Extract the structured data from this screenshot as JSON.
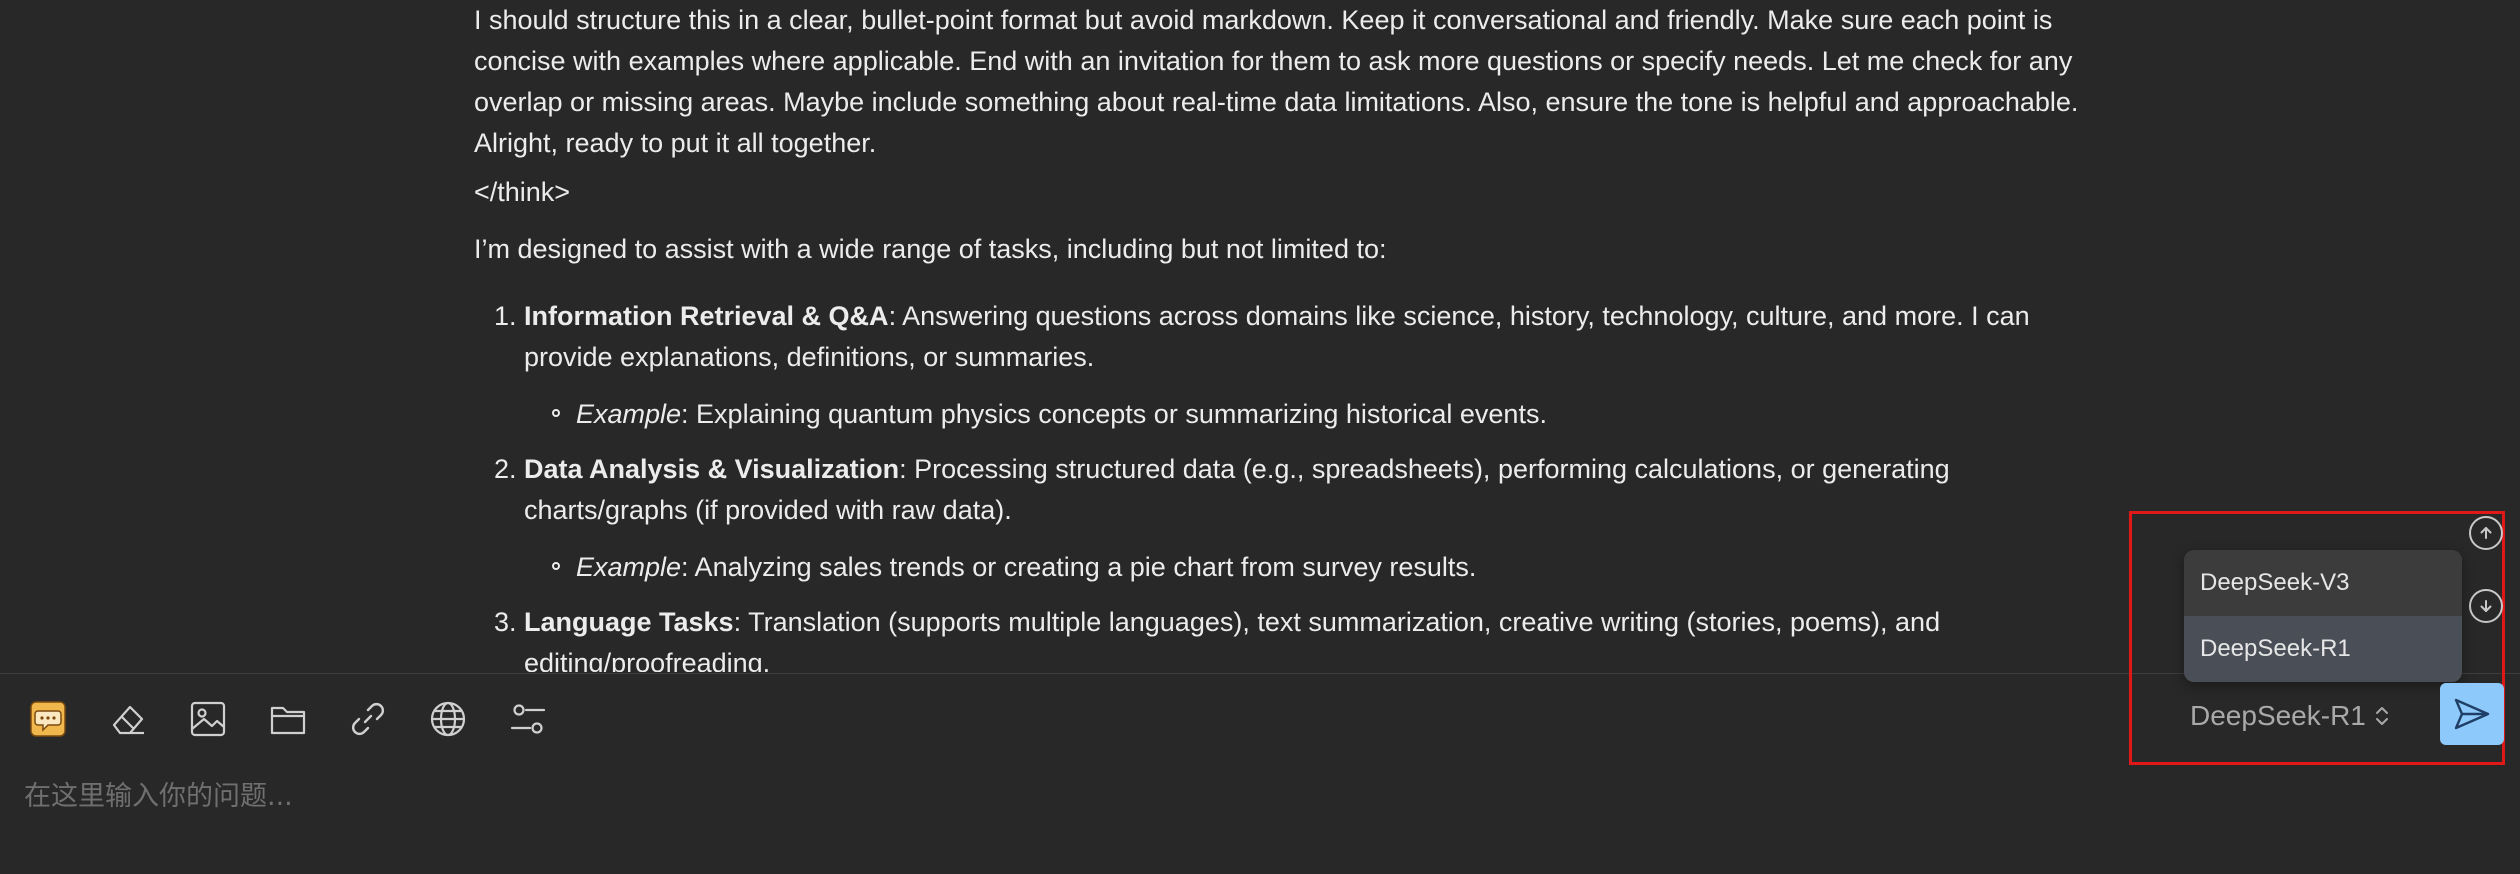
{
  "message": {
    "think_paragraph": "I should structure this in a clear, bullet-point format but avoid markdown. Keep it conversational and friendly. Make sure each point is concise with examples where applicable. End with an invitation for them to ask more questions or specify needs. Let me check for any overlap or missing areas. Maybe include something about real-time data limitations. Also, ensure the tone is helpful and approachable. Alright, ready to put it all together.",
    "think_close_tag": "</think>",
    "intro": "I’m designed to assist with a wide range of tasks, including but not limited to:",
    "items": [
      {
        "title": "Information Retrieval & Q&A",
        "text": ": Answering questions across domains like science, history, technology, culture, and more. I can provide explanations, definitions, or summaries.",
        "example_label": "Example",
        "example_text": ": Explaining quantum physics concepts or summarizing historical events."
      },
      {
        "title": "Data Analysis & Visualization",
        "text": ": Processing structured data (e.g., spreadsheets), performing calculations, or generating charts/graphs (if provided with raw data).",
        "example_label": "Example",
        "example_text": ": Analyzing sales trends or creating a pie chart from survey results."
      },
      {
        "title": "Language Tasks",
        "text": ": Translation (supports multiple languages), text summarization, creative writing (stories, poems), and editing/proofreading."
      }
    ]
  },
  "input": {
    "placeholder": "在这里输入你的问题...",
    "value": ""
  },
  "toolbar": {
    "icons": [
      "chat-mode-icon",
      "eraser-icon",
      "image-icon",
      "folder-icon",
      "link-icon",
      "globe-icon",
      "settings-sliders-icon"
    ]
  },
  "model_selector": {
    "current": "DeepSeek-R1",
    "options": [
      "DeepSeek-V3",
      "DeepSeek-R1"
    ],
    "selected_index": 1
  },
  "colors": {
    "background": "#282828",
    "send_button": "#8ec9fb",
    "highlight_border": "#e01818",
    "dropdown_bg": "#3c3c3c",
    "dropdown_selected": "#4a4f57",
    "chat_icon": "#f0b74c"
  }
}
